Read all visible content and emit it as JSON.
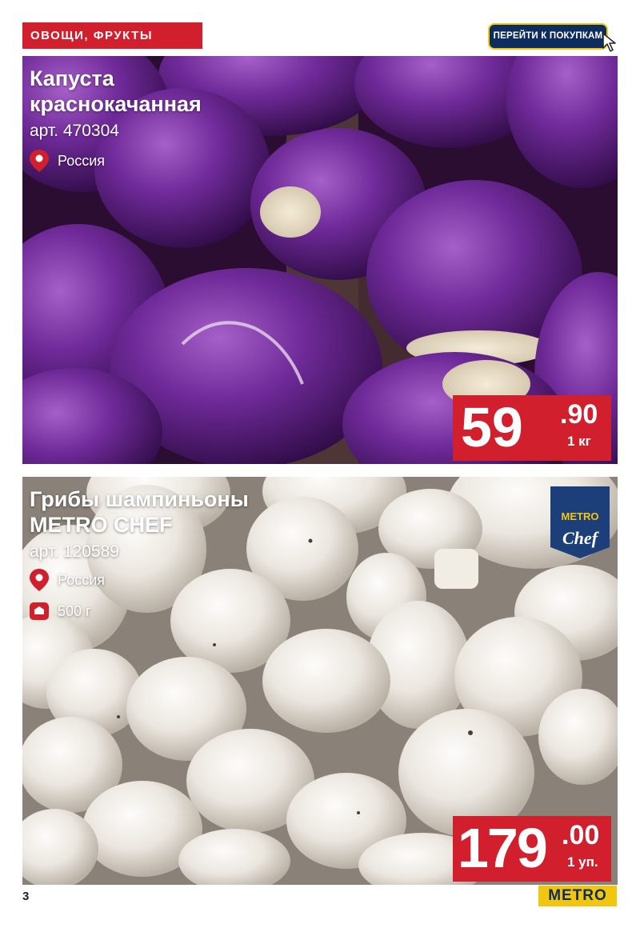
{
  "category": {
    "label": "ОВОЩИ, ФРУКТЫ"
  },
  "shop_button": {
    "label": "ПЕРЕЙТИ К ПОКУПКАМ"
  },
  "products": [
    {
      "title_line1": "Капуста",
      "title_line2": "краснокачанная",
      "article": "арт. 470304",
      "origin": "Россия",
      "price_int": "59",
      "price_dec": ".90",
      "price_unit": "1 кг"
    },
    {
      "title_line1": "Грибы шампиньоны",
      "title_line2": "METRO CHEF",
      "article": "арт. 120589",
      "origin": "Россия",
      "weight": "500 г",
      "price_int": "179",
      "price_dec": ".00",
      "price_unit": "1 уп.",
      "badge_line1": "METRO",
      "badge_line2": "Chef"
    }
  ],
  "footer": {
    "page_number": "3",
    "logo": "METRO"
  },
  "icons": {
    "location": "location-pin-icon",
    "weight": "weight-icon",
    "cursor": "cursor-icon"
  },
  "colors": {
    "accent_red": "#d21f2d",
    "metro_navy": "#0d2d5e",
    "metro_yellow": "#f2c60f"
  }
}
